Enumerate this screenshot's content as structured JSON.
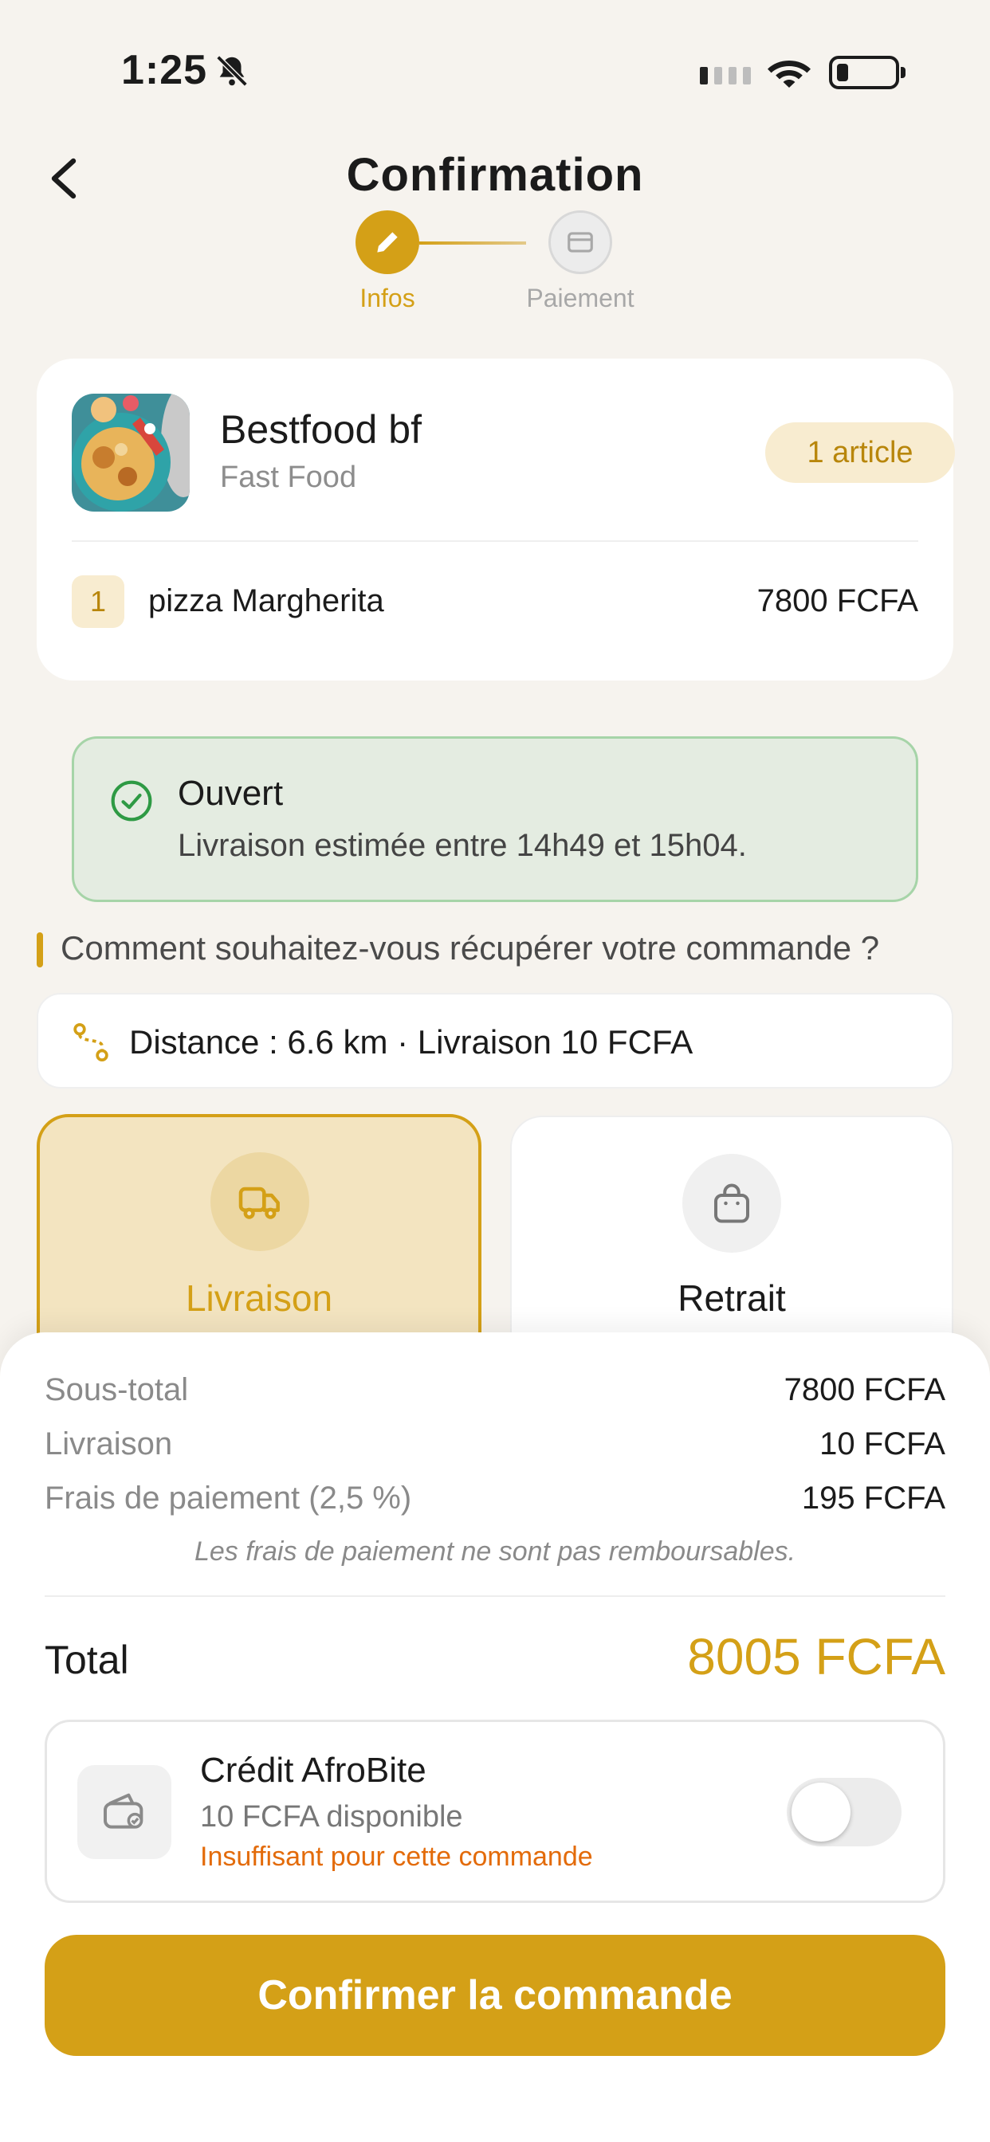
{
  "status_bar": {
    "time": "1:25"
  },
  "header": {
    "title": "Confirmation"
  },
  "stepper": {
    "step1_label": "Infos",
    "step2_label": "Paiement"
  },
  "restaurant": {
    "name": "Bestfood bf",
    "category": "Fast Food",
    "badge": "1 article",
    "items": [
      {
        "qty": "1",
        "name": "pizza Margherita",
        "price": "7800 FCFA"
      }
    ]
  },
  "open_status": {
    "title": "Ouvert",
    "text": "Livraison estimée entre 14h49 et 15h04."
  },
  "question": "Comment souhaitez-vous récupérer votre commande ?",
  "distance": "Distance : 6.6 km · Livraison 10 FCFA",
  "options": {
    "delivery": "Livraison",
    "pickup": "Retrait"
  },
  "summary": {
    "subtotal_label": "Sous-total",
    "subtotal_value": "7800 FCFA",
    "delivery_label": "Livraison",
    "delivery_value": "10 FCFA",
    "fees_label": "Frais de paiement (2,5 %)",
    "fees_value": "195 FCFA",
    "note": "Les frais de paiement ne sont pas remboursables.",
    "total_label": "Total",
    "total_value": "8005 FCFA"
  },
  "credit": {
    "title": "Crédit AfroBite",
    "available": "10 FCFA disponible",
    "warning": "Insuffisant pour cette commande",
    "enabled": false
  },
  "confirm_label": "Confirmer la commande",
  "colors": {
    "accent": "#d4a017",
    "success_bg": "#e4ece1",
    "warning": "#e36b0a"
  }
}
